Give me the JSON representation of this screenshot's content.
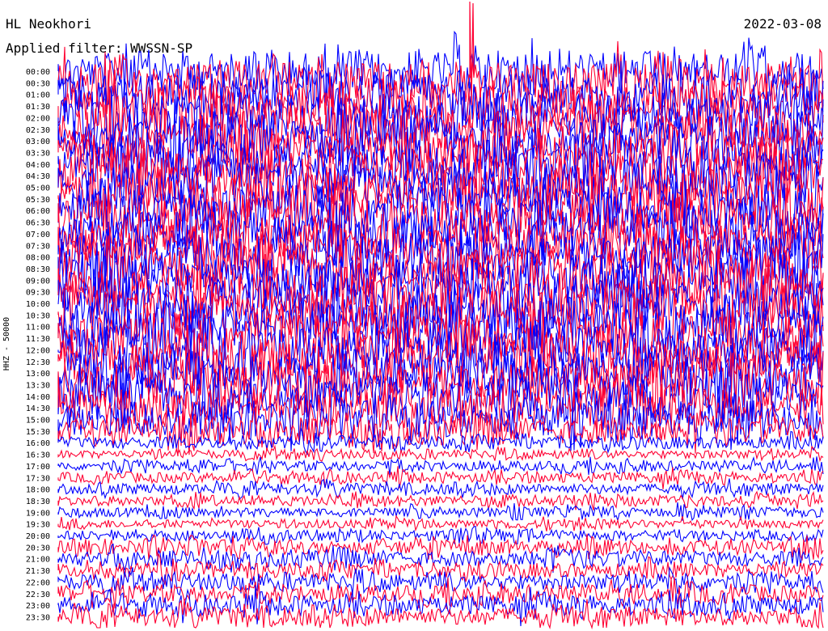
{
  "header": {
    "station": "HL Neokhori",
    "date": "2022-03-08",
    "filter_label": "Applied filter: WWSSN-SP"
  },
  "chart_data": {
    "type": "line",
    "title": "HL Neokhori",
    "date": "2022-03-08",
    "subtitle": "Applied filter: WWSSN-SP",
    "ylabel": "HHZ - 50000",
    "row_labels": [
      "00:00",
      "00:30",
      "01:00",
      "01:30",
      "02:00",
      "02:30",
      "03:00",
      "03:30",
      "04:00",
      "04:30",
      "05:00",
      "05:30",
      "06:00",
      "06:30",
      "07:00",
      "07:30",
      "08:00",
      "08:30",
      "09:00",
      "09:30",
      "10:00",
      "10:30",
      "11:00",
      "11:30",
      "12:00",
      "12:30",
      "13:00",
      "13:30",
      "14:00",
      "14:30",
      "15:00",
      "15:30",
      "16:00",
      "16:30",
      "17:00",
      "17:30",
      "18:00",
      "18:30",
      "19:00",
      "19:30",
      "20:00",
      "20:30",
      "21:00",
      "21:30",
      "22:00",
      "22:30",
      "23:00",
      "23:30"
    ],
    "colors": [
      "#0000ff",
      "#ff0033"
    ],
    "relative_amplitude": [
      3.2,
      3.4,
      3.4,
      3.5,
      3.6,
      3.7,
      3.7,
      3.8,
      3.8,
      3.8,
      3.9,
      3.9,
      3.9,
      3.9,
      3.9,
      3.9,
      3.9,
      3.9,
      3.9,
      3.9,
      3.9,
      3.9,
      3.9,
      3.9,
      3.9,
      3.9,
      3.9,
      3.8,
      3.6,
      3.3,
      2.8,
      2.1,
      1.0,
      0.7,
      0.8,
      0.9,
      0.9,
      0.9,
      0.8,
      0.7,
      0.9,
      1.1,
      1.3,
      1.2,
      1.3,
      1.4,
      1.6,
      1.5
    ],
    "grid": false,
    "legend": "none"
  }
}
